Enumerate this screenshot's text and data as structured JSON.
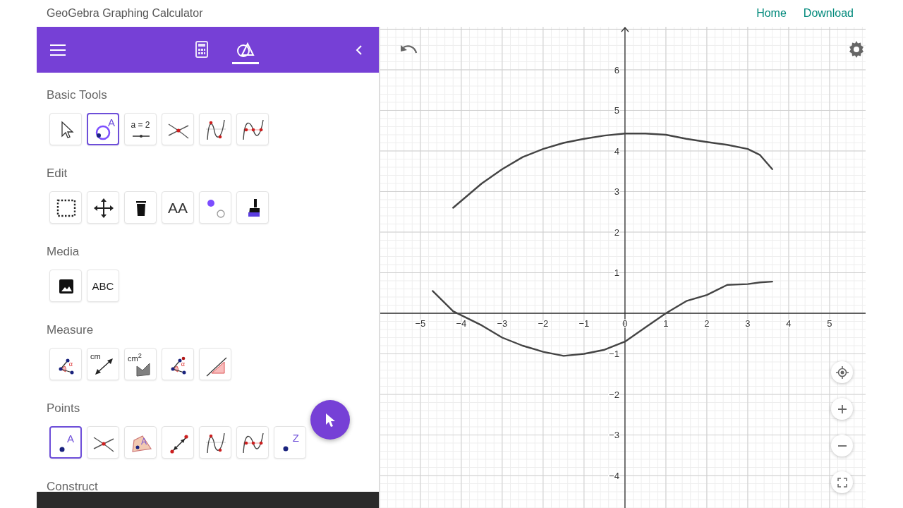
{
  "header": {
    "title": "GeoGebra Graphing Calculator",
    "links": [
      "Home",
      "Download"
    ]
  },
  "toolbar": {
    "tabs": [
      {
        "selected": false
      },
      {
        "selected": true
      }
    ]
  },
  "tool_sections": [
    {
      "title": "Basic Tools",
      "tools": [
        {
          "kind": "move",
          "selected": false
        },
        {
          "kind": "point-on-object",
          "selected": true,
          "label": "A"
        },
        {
          "kind": "slider",
          "selected": false,
          "label": "a = 2"
        },
        {
          "kind": "intersect",
          "selected": false
        },
        {
          "kind": "extremum",
          "selected": false
        },
        {
          "kind": "roots",
          "selected": false
        }
      ]
    },
    {
      "title": "Edit",
      "tools": [
        {
          "kind": "select-rect",
          "selected": false
        },
        {
          "kind": "move-graphics",
          "selected": false
        },
        {
          "kind": "delete",
          "selected": false
        },
        {
          "kind": "text-style",
          "selected": false,
          "label": "AA"
        },
        {
          "kind": "style-dots",
          "selected": false
        },
        {
          "kind": "pen-brush",
          "selected": false
        }
      ]
    },
    {
      "title": "Media",
      "tools": [
        {
          "kind": "image",
          "selected": false
        },
        {
          "kind": "text",
          "selected": false,
          "label": "ABC"
        }
      ]
    },
    {
      "title": "Measure",
      "tools": [
        {
          "kind": "angle",
          "selected": false,
          "label": "α"
        },
        {
          "kind": "distance",
          "selected": false,
          "label": "cm"
        },
        {
          "kind": "area",
          "selected": false,
          "label": "cm$^{2}$"
        },
        {
          "kind": "angle-size",
          "selected": false,
          "label": "α"
        },
        {
          "kind": "slope",
          "selected": false
        }
      ]
    },
    {
      "title": "Points",
      "tools": [
        {
          "kind": "point",
          "selected": true,
          "label": "A"
        },
        {
          "kind": "intersect",
          "selected": false
        },
        {
          "kind": "point-in-region",
          "selected": false,
          "label": "A"
        },
        {
          "kind": "attach-detach",
          "selected": false
        },
        {
          "kind": "extremum",
          "selected": false
        },
        {
          "kind": "roots",
          "selected": false
        },
        {
          "kind": "complex-point",
          "selected": false,
          "label": "Z"
        }
      ]
    },
    {
      "title": "Construct"
    }
  ],
  "graph": {
    "chart_data": {
      "type": "line",
      "x": [
        -4.7,
        -4.2,
        -3.5,
        -3,
        -2.5,
        -2,
        -1.5,
        -1,
        -0.5,
        0,
        0.5,
        1,
        1.5,
        2,
        2.5,
        3,
        3.3,
        3.6
      ],
      "series": [
        {
          "color": "#444444",
          "values": [
            null,
            2.6,
            3.2,
            3.55,
            3.85,
            4.05,
            4.2,
            4.3,
            4.38,
            4.43,
            4.43,
            4.4,
            4.3,
            4.22,
            4.15,
            4.05,
            3.9,
            3.55
          ]
        },
        {
          "color": "#444444",
          "values": [
            0.55,
            0.05,
            -0.3,
            -0.6,
            -0.8,
            -0.95,
            -1.05,
            -1.0,
            -0.9,
            -0.7,
            -0.35,
            0,
            0.3,
            0.45,
            0.7,
            0.72,
            0.76,
            0.78
          ]
        }
      ],
      "xlim": [
        -5.98,
        5.88
      ],
      "ylim": [
        -4.8,
        7.06
      ],
      "grid": true,
      "xticks": [
        -5,
        -4,
        -3,
        -2,
        -1,
        0,
        1,
        2,
        3,
        4,
        5
      ],
      "yticks": [
        -4,
        -3,
        -2,
        -1,
        1,
        2,
        3,
        4,
        5,
        6
      ]
    }
  }
}
